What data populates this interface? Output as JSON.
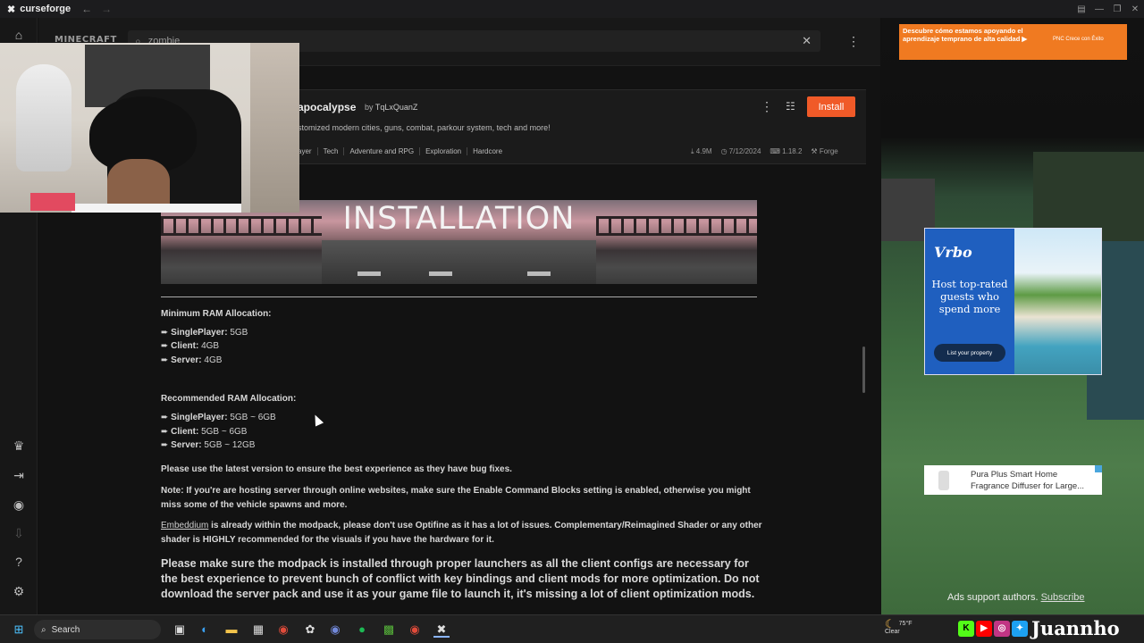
{
  "app": {
    "title": "curseforge",
    "back": "←",
    "forward": "→"
  },
  "window_controls": [
    "▤",
    "—",
    "❐",
    "✕"
  ],
  "header": {
    "game": "MINECRAFT",
    "search": {
      "value": "zombie",
      "placeholder": "Search"
    },
    "clear": "✕",
    "more": "⋮"
  },
  "mod": {
    "title": "apocalypse",
    "by_prefix": "by",
    "author": "TqLxQuanZ",
    "description": "stomized modern cities, guns, combat, parkour system, tech and more!",
    "tags": [
      "ayer",
      "Tech",
      "Adventure and RPG",
      "Exploration",
      "Hardcore"
    ],
    "downloads": "4.9M",
    "updated": "7/12/2024",
    "version": "1.18.2",
    "loader": "Forge",
    "install_label": "Install",
    "more": "⋮",
    "grid": "☷"
  },
  "banner": {
    "title": "INSTALLATION"
  },
  "content": {
    "min_heading": "Minimum RAM Allocation:",
    "min_items": [
      {
        "label": "SinglePlayer:",
        "value": "5GB"
      },
      {
        "label": "Client:",
        "value": "4GB"
      },
      {
        "label": "Server:",
        "value": "4GB"
      }
    ],
    "rec_heading": "Recommended RAM Allocation:",
    "rec_items": [
      {
        "label": "SinglePlayer:",
        "value": "5GB ~ 6GB"
      },
      {
        "label": "Client:",
        "value": "5GB ~ 6GB"
      },
      {
        "label": "Server:",
        "value": "5GB ~ 12GB"
      }
    ],
    "p1": "Please use the latest version to ensure the best experience as they have bug fixes.",
    "p2": "Note: If you're are hosting server through online websites, make sure the Enable Command Blocks setting is enabled, otherwise you might miss some of the vehicle spawns and more.",
    "p3_link": "Embeddium",
    "p3_rest": " is already within the modpack, please don't use Optifine as it has a lot of issues. Complementary/Reimagined Shader or any other shader is HIGHLY recommended for the visuals if you have the hardware for it.",
    "p4": "Please make sure the modpack is installed through proper launchers as all the client configs are necessary for the best experience to prevent bunch of conflict with key bindings and client mods for more optimization. Do not download the server pack and use it as your game file to launch it, it's missing a lot of client optimization mods."
  },
  "ads": {
    "top": {
      "text": "Descubre cómo estamos apoyando el aprendizaje temprano de alta calidad ▶",
      "logo": "PNC  Crece con Éxito"
    },
    "vrbo": {
      "brand": "Vrbo",
      "tagline": "Host top-rated guests who spend more",
      "button": "List your property"
    },
    "small": {
      "text": "Pura Plus Smart Home Fragrance Diffuser for Large..."
    },
    "support": "Ads support authors.",
    "subscribe": "Subscribe"
  },
  "taskbar": {
    "search": "Search",
    "weather_temp": "75°F",
    "weather_desc": "Clear",
    "handle": "Juannho"
  }
}
